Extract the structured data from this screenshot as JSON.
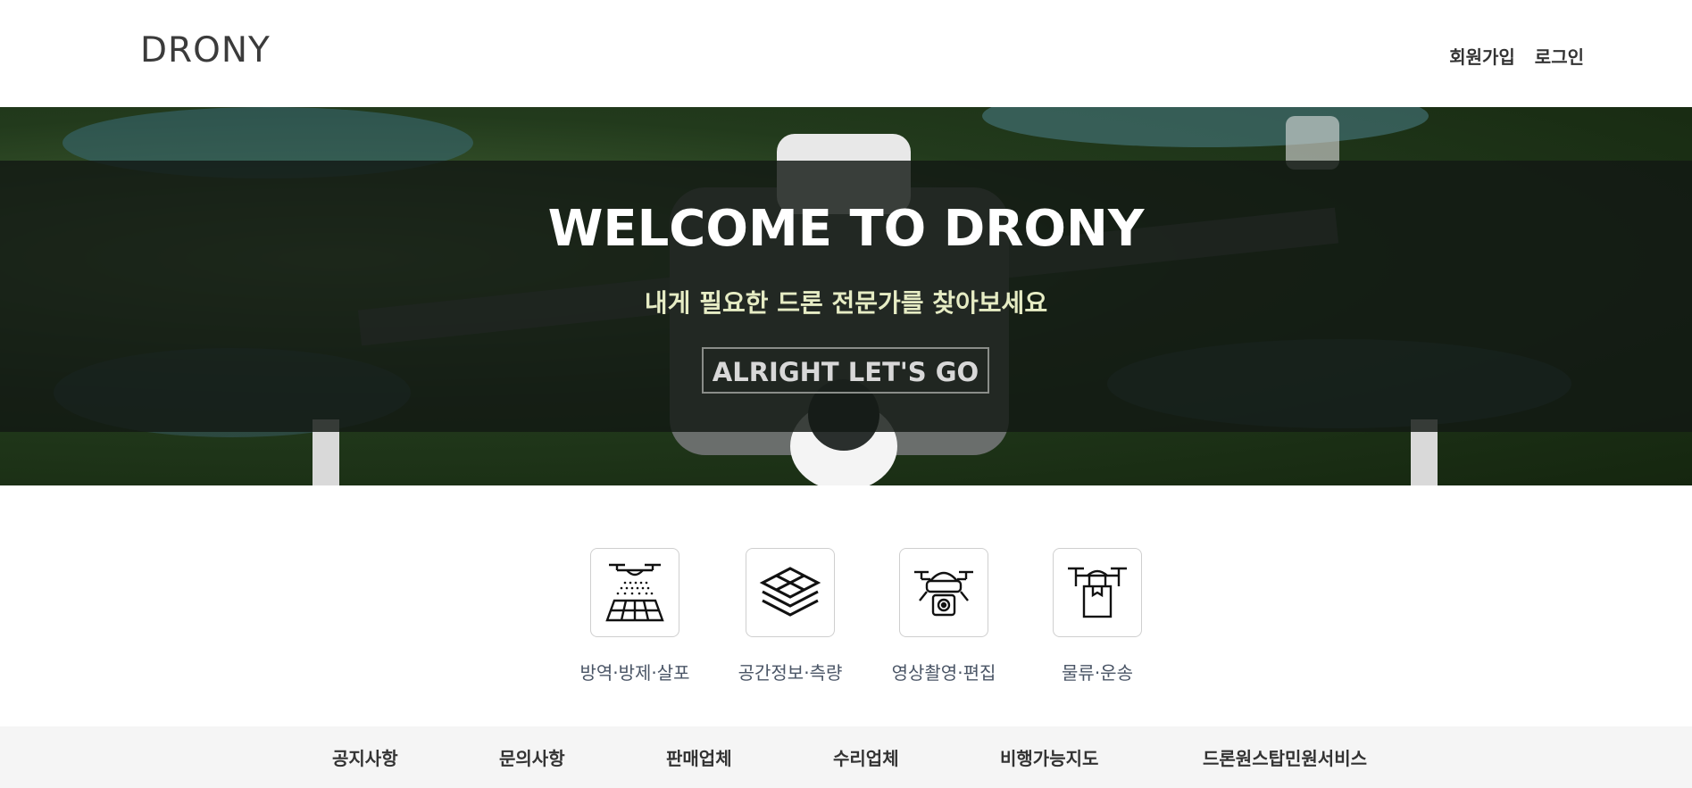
{
  "header": {
    "logo": "DRONY",
    "signup": "회원가입",
    "login": "로그인"
  },
  "hero": {
    "title": "WELCOME TO DRONY",
    "subtitle": "내게 필요한 드론 전문가를 찾아보세요",
    "cta": "ALRIGHT LET'S GO"
  },
  "services": [
    {
      "label": "방역·방제·살포",
      "icon": "crop-spraying-drone-icon"
    },
    {
      "label": "공간정보·측량",
      "icon": "layers-grid-icon"
    },
    {
      "label": "영상촬영·편집",
      "icon": "camera-drone-icon"
    },
    {
      "label": "물류·운송",
      "icon": "delivery-drone-icon"
    }
  ],
  "nav": [
    "공지사항",
    "문의사항",
    "판매업체",
    "수리업체",
    "비행가능지도",
    "드론원스탑민원서비스"
  ]
}
